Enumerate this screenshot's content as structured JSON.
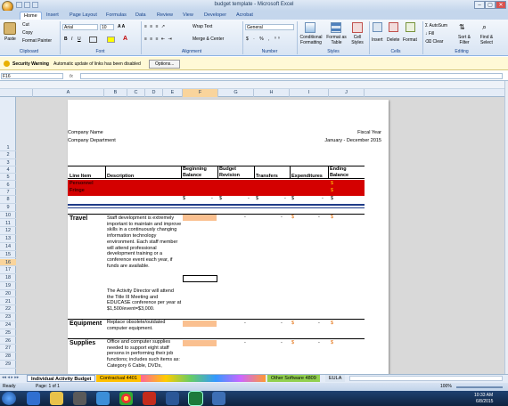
{
  "window": {
    "title": "budget template - Microsoft Excel",
    "min": "–",
    "max": "▢",
    "close": "✕"
  },
  "ribbon_tabs": [
    "Home",
    "Insert",
    "Page Layout",
    "Formulas",
    "Data",
    "Review",
    "View",
    "Developer",
    "Acrobat"
  ],
  "clipboard": {
    "paste": "Paste",
    "cut": "Cut",
    "copy": "Copy",
    "format_painter": "Format Painter",
    "label": "Clipboard"
  },
  "font": {
    "name": "Arial",
    "size": "10",
    "label": "Font"
  },
  "alignment": {
    "wrap": "Wrap Text",
    "merge": "Merge & Center",
    "label": "Alignment"
  },
  "number": {
    "format": "General",
    "label": "Number"
  },
  "styles": {
    "conditional": "Conditional Formatting",
    "format_table": "Format as Table",
    "cell_styles": "Cell Styles",
    "label": "Styles"
  },
  "cells": {
    "insert": "Insert",
    "delete": "Delete",
    "format": "Format",
    "label": "Cells"
  },
  "editing": {
    "autosum": "AutoSum",
    "fill": "Fill",
    "clear": "Clear",
    "sort": "Sort & Filter",
    "find": "Find & Select",
    "label": "Editing"
  },
  "security": {
    "title": "Security Warning",
    "message": "Automatic update of links has been disabled",
    "options": "Options..."
  },
  "formula_bar": {
    "name_box": "F16",
    "fx": "fx",
    "value": ""
  },
  "columns": [
    "A",
    "B",
    "C",
    "D",
    "E",
    "F",
    "G",
    "H",
    "I",
    "J"
  ],
  "rows": [
    "1",
    "2",
    "3",
    "4",
    "5",
    "6",
    "7",
    "8",
    "9",
    "10",
    "11",
    "12",
    "13",
    "14",
    "15",
    "16",
    "17",
    "18",
    "19",
    "20",
    "21",
    "22",
    "23",
    "24",
    "25",
    "26",
    "27",
    "28",
    "29"
  ],
  "sheet": {
    "company_name": "Company Name",
    "company_dept": "Company Department",
    "fiscal_year": "Fiscal Year",
    "period": "January - December 2015",
    "headers": [
      "Line Item",
      "Description",
      "Beginning Balance",
      "Budget Revision",
      "Transfers",
      "Expenditures",
      "Ending Balance"
    ],
    "personnel": "Personnel",
    "fringe": "Fringe",
    "dollar": "$",
    "dash": "-",
    "travel": "Travel",
    "travel_desc1": "Staff development is extremely important to maintain and improve skills in a continuously changing information technology environment. Each staff member will attend professional development training or a conference event each year, if funds are available.",
    "travel_desc2": "The Activity Director will attend the Title III Meeting and EDUCASE conference per year at $1,500/event=$3,000.",
    "equipment": "Equipment",
    "equipment_desc": "Replace obsolete/outdated computer equipment.",
    "supplies": "Supplies",
    "supplies_desc": "Office and computer supplies needed to support eight staff persons in performing their job functions; includes such items as: Category 6 Cable, DVDs,"
  },
  "sheet_tabs": [
    "Individual Activity Budget",
    "Contractual 4401",
    "Other Software 4809",
    "EULA"
  ],
  "status": {
    "ready": "Ready",
    "page": "Page: 1 of 1",
    "zoom": "100%"
  },
  "clock": {
    "time": "10:33 AM",
    "date": "6/8/2015"
  }
}
